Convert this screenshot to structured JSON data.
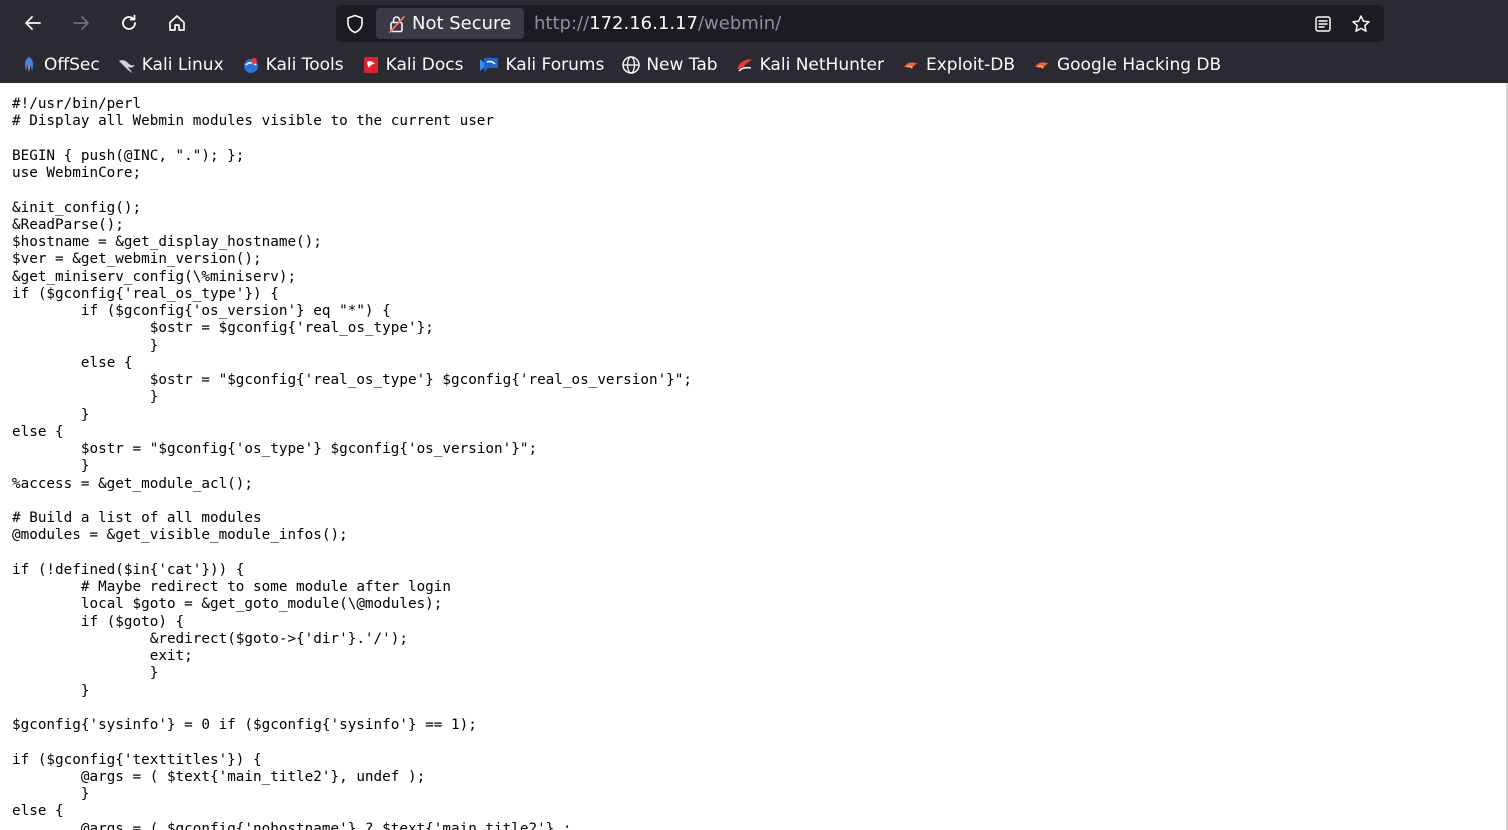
{
  "browser": {
    "security_label": "Not Secure",
    "url_scheme": "http://",
    "url_host": "172.16.1.17",
    "url_path": "/webmin/",
    "icons": {
      "back": "arrow-left-icon",
      "forward": "arrow-right-icon",
      "reload": "reload-icon",
      "home": "home-icon",
      "shield": "shield-icon",
      "lock": "lock-warning-icon",
      "reader": "reader-view-icon",
      "bookmark_star": "star-icon"
    },
    "colors": {
      "chrome_bg": "#2b2a33",
      "url_bg": "#1c1b22",
      "text": "#fbfbfe",
      "muted": "#8f8f9d"
    }
  },
  "bookmarks": [
    {
      "label": "OffSec",
      "icon": "offsec-icon"
    },
    {
      "label": "Kali Linux",
      "icon": "kali-dragon-icon"
    },
    {
      "label": "Kali Tools",
      "icon": "kali-tools-icon"
    },
    {
      "label": "Kali Docs",
      "icon": "kali-docs-icon"
    },
    {
      "label": "Kali Forums",
      "icon": "kali-forums-icon"
    },
    {
      "label": "New Tab",
      "icon": "globe-icon"
    },
    {
      "label": "Kali NetHunter",
      "icon": "nethunter-icon"
    },
    {
      "label": "Exploit-DB",
      "icon": "exploit-db-icon"
    },
    {
      "label": "Google Hacking DB",
      "icon": "ghdb-icon"
    }
  ],
  "source": "#!/usr/bin/perl\n# Display all Webmin modules visible to the current user\n\nBEGIN { push(@INC, \".\"); };\nuse WebminCore;\n\n&init_config();\n&ReadParse();\n$hostname = &get_display_hostname();\n$ver = &get_webmin_version();\n&get_miniserv_config(\\%miniserv);\nif ($gconfig{'real_os_type'}) {\n\tif ($gconfig{'os_version'} eq \"*\") {\n\t\t$ostr = $gconfig{'real_os_type'};\n\t\t}\n\telse {\n\t\t$ostr = \"$gconfig{'real_os_type'} $gconfig{'real_os_version'}\";\n\t\t}\n\t}\nelse {\n\t$ostr = \"$gconfig{'os_type'} $gconfig{'os_version'}\";\n\t}\n%access = &get_module_acl();\n\n# Build a list of all modules\n@modules = &get_visible_module_infos();\n\nif (!defined($in{'cat'})) {\n\t# Maybe redirect to some module after login\n\tlocal $goto = &get_goto_module(\\@modules);\n\tif ($goto) {\n\t\t&redirect($goto->{'dir'}.'/');\n\t\texit;\n\t\t}\n\t}\n\n$gconfig{'sysinfo'} = 0 if ($gconfig{'sysinfo'} == 1);\n\nif ($gconfig{'texttitles'}) {\n\t@args = ( $text{'main_title2'}, undef );\n\t}\nelse {\n\t@args = ( $gconfig{'nohostname'} ? $text{'main_title2'} :"
}
